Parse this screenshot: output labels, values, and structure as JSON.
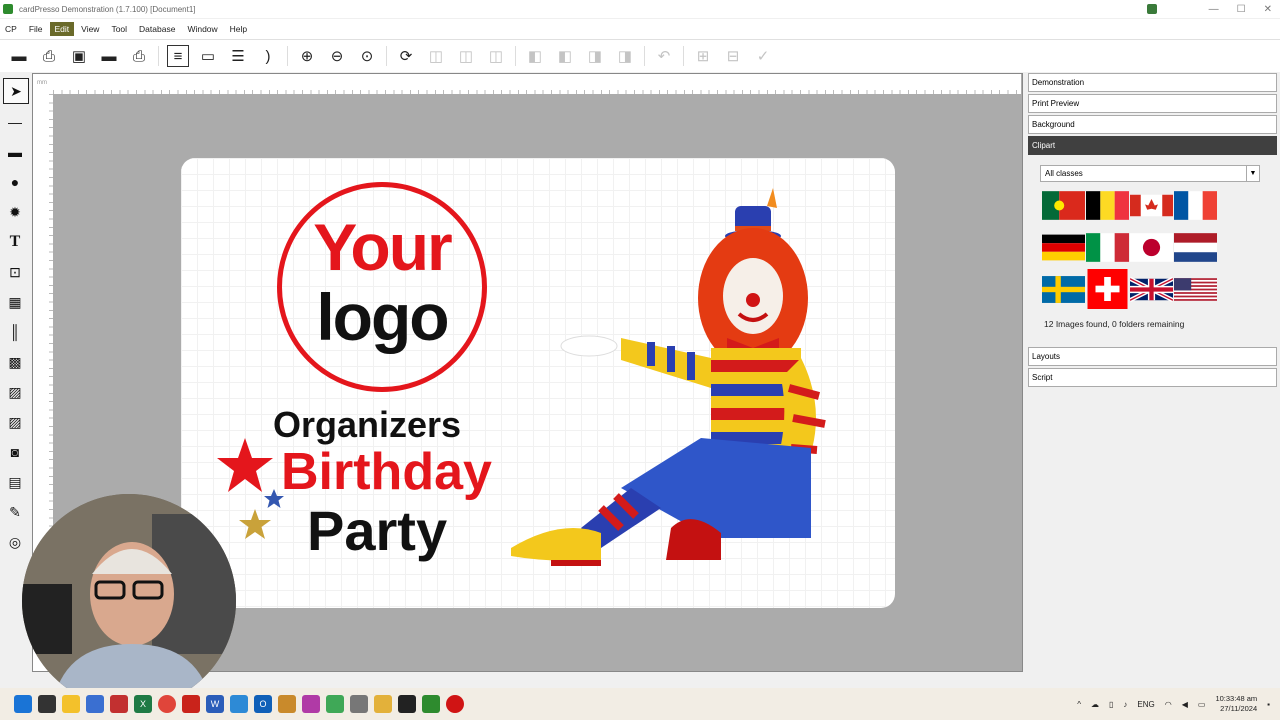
{
  "window": {
    "title": "cardPresso Demonstration (1.7.100) [Document1]"
  },
  "menu": {
    "items": [
      "CP",
      "File",
      "Edit",
      "View",
      "Tool",
      "Database",
      "Window",
      "Help"
    ],
    "active": "Edit"
  },
  "toolbar": {
    "icons": [
      "new-icon",
      "open-icon",
      "save-icon",
      "close-doc-icon",
      "print-icon",
      "card-view-icon",
      "magstripe-icon",
      "layers-icon",
      "contactless-icon",
      "zoom-in-icon",
      "zoom-out-icon",
      "zoom-fit-icon",
      "rotate-icon",
      "align-icon",
      "distribute-icon",
      "undo-icon",
      "redo-icon"
    ]
  },
  "ruler": {
    "unit": "mm"
  },
  "card": {
    "logo_line1": "Your",
    "logo_line2": "logo",
    "line1": "Organizers",
    "line2": "Birthday",
    "line3": "Party"
  },
  "right_panel": {
    "sections": [
      "Demonstration",
      "Print Preview",
      "Background",
      "Clipart",
      "Layouts",
      "Script"
    ],
    "active_section": "Clipart",
    "clipart_filter": "All classes",
    "flags": [
      "portugal",
      "belgium",
      "canada",
      "france",
      "germany",
      "italy",
      "japan",
      "netherlands",
      "sweden",
      "switzerland",
      "united-kingdom",
      "united-states"
    ],
    "status": "12 Images found, 0 folders remaining"
  },
  "taskbar": {
    "time": "10:33:48 am",
    "date": "27/11/2024",
    "language": "ENG"
  },
  "colors": {
    "accent_red": "#e4161c",
    "active_section": "#404040",
    "canvas": "#ababab"
  }
}
